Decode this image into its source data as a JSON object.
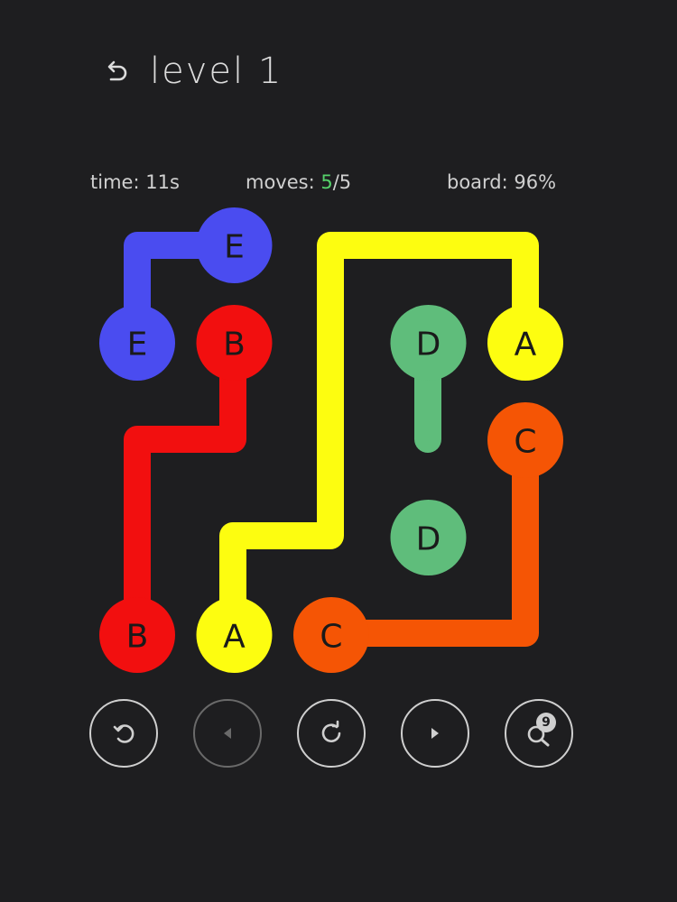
{
  "header": {
    "title": "level 1",
    "back_icon": "undo-arrow-icon"
  },
  "stats": {
    "time_label": "time:",
    "time_value": "11s",
    "moves_label": "moves:",
    "moves_current": "5",
    "moves_total": "/5",
    "board_label": "board:",
    "board_value": "96%"
  },
  "colors": {
    "background": "#1e1e20",
    "blue": "#4a4cf0",
    "red": "#f20f0f",
    "yellow": "#fdfd10",
    "green": "#5fbd7b",
    "orange": "#f55505",
    "moves_highlight": "#55d16a"
  },
  "board": {
    "grid_size": 5,
    "nodes": [
      {
        "label": "E",
        "color": "blue",
        "cell": [
          1,
          0
        ]
      },
      {
        "label": "E",
        "color": "blue",
        "cell": [
          0,
          1
        ]
      },
      {
        "label": "B",
        "color": "red",
        "cell": [
          1,
          1
        ]
      },
      {
        "label": "B",
        "color": "red",
        "cell": [
          0,
          4
        ]
      },
      {
        "label": "D",
        "color": "green",
        "cell": [
          3,
          1
        ]
      },
      {
        "label": "D",
        "color": "green",
        "cell": [
          3,
          3
        ]
      },
      {
        "label": "A",
        "color": "yellow",
        "cell": [
          4,
          1
        ]
      },
      {
        "label": "A",
        "color": "yellow",
        "cell": [
          1,
          4
        ]
      },
      {
        "label": "C",
        "color": "orange",
        "cell": [
          4,
          2
        ]
      },
      {
        "label": "C",
        "color": "orange",
        "cell": [
          2,
          4
        ]
      }
    ]
  },
  "controls": [
    {
      "name": "undo-button",
      "icon": "undo-icon",
      "disabled": false
    },
    {
      "name": "previous-level-button",
      "icon": "play-left-icon",
      "disabled": true
    },
    {
      "name": "restart-button",
      "icon": "restart-icon",
      "disabled": false
    },
    {
      "name": "next-level-button",
      "icon": "play-right-icon",
      "disabled": false
    },
    {
      "name": "hint-button",
      "icon": "magnifier-icon",
      "disabled": false,
      "badge": "9"
    }
  ]
}
